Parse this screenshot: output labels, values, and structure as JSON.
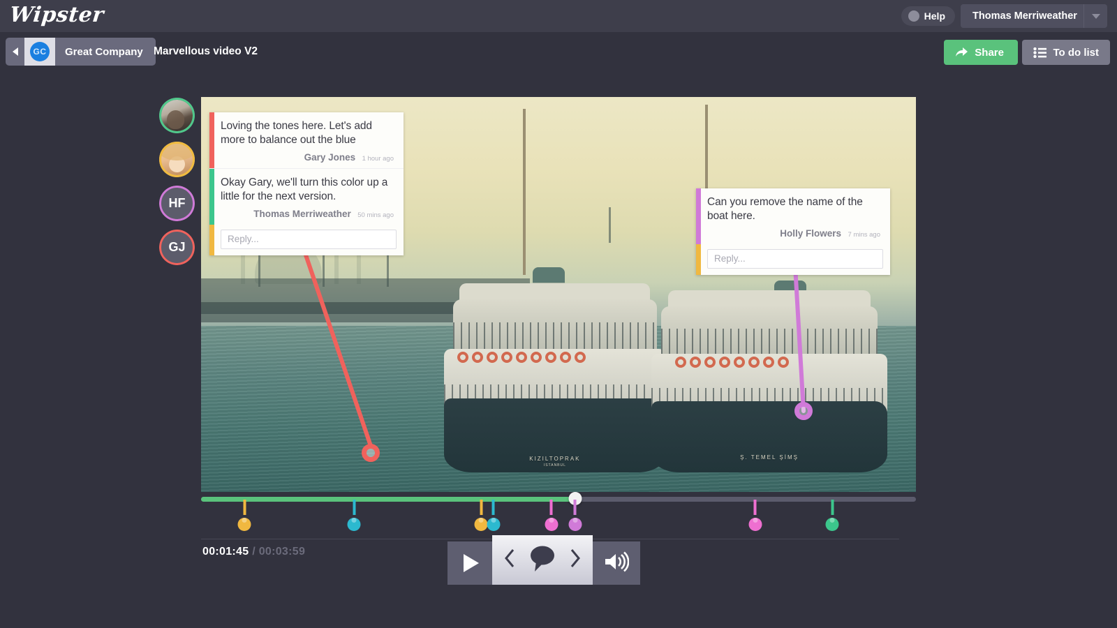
{
  "app": {
    "logo": "Wipster"
  },
  "topbar": {
    "help_label": "Help",
    "user_name": "Thomas Merriweather"
  },
  "subbar": {
    "company_initials": "GC",
    "company_name": "Great Company",
    "video_title": "Marvellous video V2",
    "share_label": "Share",
    "todo_label": "To do list"
  },
  "rail": {
    "avatars": [
      {
        "name": "avatar-photo-1",
        "initials": "",
        "ring": "#4fc88b",
        "type": "photo-a"
      },
      {
        "name": "avatar-photo-2",
        "initials": "",
        "ring": "#f0bb3f",
        "type": "photo-b"
      },
      {
        "name": "avatar-holly-flowers",
        "initials": "HF",
        "ring": "#d07ad8",
        "type": "initials"
      },
      {
        "name": "avatar-gary-jones",
        "initials": "GJ",
        "ring": "#f0625c",
        "type": "initials"
      }
    ]
  },
  "comments": {
    "thread_left": {
      "items": [
        {
          "body": "Loving the tones here. Let's add more to balance out the blue",
          "author": "Gary Jones",
          "time": "1 hour ago",
          "bar_color": "#f0625c"
        },
        {
          "body": "Okay Gary, we'll turn this color up a little for the next version.",
          "author": "Thomas Merriweather",
          "time": "50 mins ago",
          "bar_color": "#3cc68c"
        }
      ],
      "reply_placeholder": "Reply...",
      "reply_value": "",
      "marker_color": "#f0625c"
    },
    "thread_right": {
      "items": [
        {
          "body": "Can you remove the name of the boat here.",
          "author": "Holly Flowers",
          "time": "7 mins ago",
          "bar_color": "#d07ad8"
        }
      ],
      "reply_placeholder": "Reply...",
      "reply_value": "",
      "marker_color": "#d07ad8"
    }
  },
  "player": {
    "current_time": "00:01:45",
    "separator": "/",
    "total_time": "00:03:59",
    "progress_percent": 52.3,
    "markers": [
      {
        "percent": 6.1,
        "color": "#f0b840"
      },
      {
        "percent": 21.4,
        "color": "#2cb9cf"
      },
      {
        "percent": 39.2,
        "color": "#f0b840"
      },
      {
        "percent": 40.8,
        "color": "#2cb9cf"
      },
      {
        "percent": 49.0,
        "color": "#ee6fd0"
      },
      {
        "percent": 52.3,
        "color": "#d07ad8"
      },
      {
        "percent": 77.5,
        "color": "#ee6fd0"
      },
      {
        "percent": 88.3,
        "color": "#3cc68c"
      }
    ],
    "play_icon": "play-icon",
    "prev_comment_icon": "chevron-left-icon",
    "comment_icon": "speech-bubble-icon",
    "next_comment_icon": "chevron-right-icon",
    "volume_icon": "volume-icon"
  },
  "video": {
    "boat_name_1": "KIZILTOPRAK",
    "boat_sub_1": "ISTANBUL",
    "boat_name_2": "Ş. TEMEL  ŞİMŞ"
  },
  "colors": {
    "bg": "#32323e",
    "topbar": "#3e3e4b",
    "accent_green": "#5ac27c",
    "progress": "#5ac27c"
  }
}
